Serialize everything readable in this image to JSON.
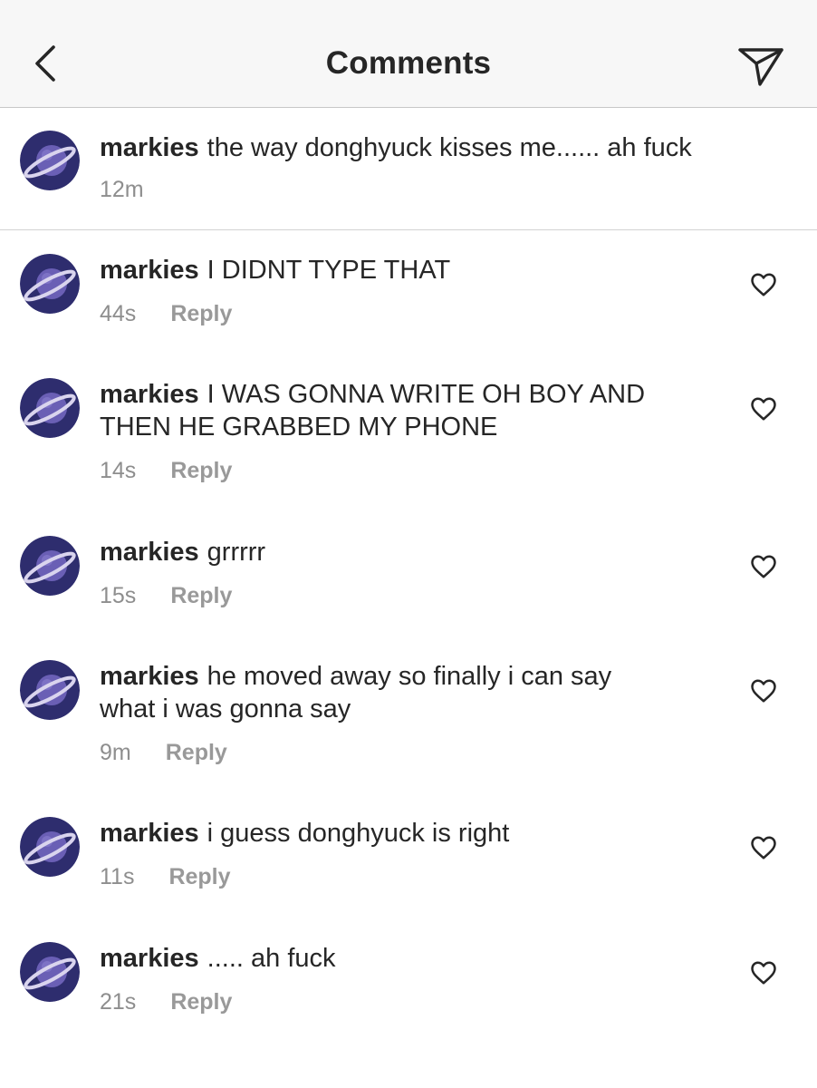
{
  "header": {
    "title": "Comments"
  },
  "caption": {
    "username": "markies",
    "text": "the way donghyuck kisses me...... ah fuck",
    "time": "12m"
  },
  "comments": [
    {
      "username": "markies",
      "text": "I DIDNT TYPE THAT",
      "time": "44s",
      "reply_label": "Reply"
    },
    {
      "username": "markies",
      "text": "I WAS GONNA WRITE OH BOY AND THEN HE GRABBED MY PHONE",
      "time": "14s",
      "reply_label": "Reply"
    },
    {
      "username": "markies",
      "text": "grrrrr",
      "time": "15s",
      "reply_label": "Reply"
    },
    {
      "username": "markies",
      "text": "he moved away so finally i can say what i was gonna say",
      "time": "9m",
      "reply_label": "Reply"
    },
    {
      "username": "markies",
      "text": "i guess donghyuck is right",
      "time": "11s",
      "reply_label": "Reply"
    },
    {
      "username": "markies",
      "text": "..... ah fuck",
      "time": "21s",
      "reply_label": "Reply"
    }
  ],
  "icons": {
    "back": "chevron-left-icon",
    "share": "paper-plane-icon",
    "like": "heart-icon",
    "avatar": "planet-avatar"
  },
  "colors": {
    "avatar_bg": "#2e2d6e",
    "planet": "#6a5fb5",
    "ring": "#d9d4ee",
    "secondary_text": "#8e8e8e"
  }
}
